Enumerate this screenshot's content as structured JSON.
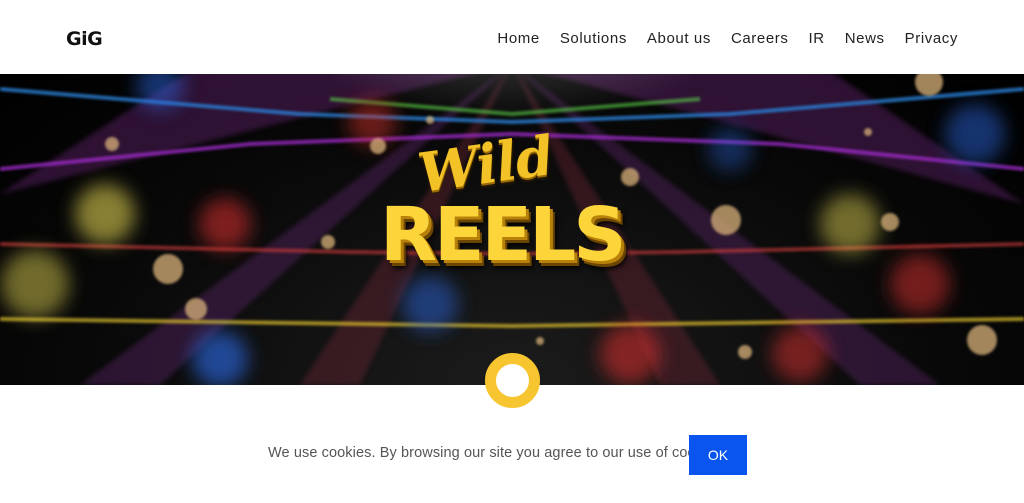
{
  "header": {
    "logo": "GiG",
    "nav": [
      "Home",
      "Solutions",
      "About us",
      "Careers",
      "IR",
      "News",
      "Privacy"
    ]
  },
  "hero": {
    "title_top": "Wild",
    "title_bottom": "REELS"
  },
  "cookie": {
    "message": "We use cookies. By browsing our site you agree to our use of cookies.",
    "ok_label": "OK"
  },
  "colors": {
    "accent_button": "#0a55f0",
    "loader_ring": "#f6c52f",
    "title_gold": "#fbd53a"
  }
}
